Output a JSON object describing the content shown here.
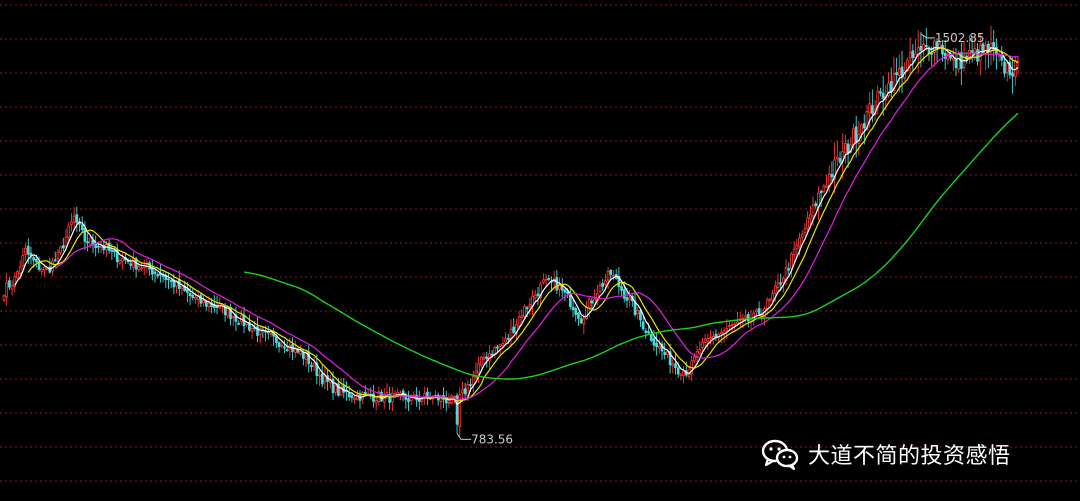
{
  "chart_data": {
    "type": "candlestick",
    "grid": true,
    "grid_style": "dotted-horizontal",
    "colors": {
      "background": "#000000",
      "grid": "#8a1a1a",
      "candle_up": "#ff3b3b",
      "candle_down": "#4fd8d8",
      "ma_short": "#ffffff",
      "ma_mid": "#e8e800",
      "ma_long": "#e020e0",
      "ma_longest": "#1bd01b",
      "annotation": "#c8c8c8"
    },
    "ylim": [
      700,
      1560
    ],
    "annotations": {
      "high_label": "1502.85",
      "low_label": "783.56"
    },
    "anchors": [
      [
        0,
        1040
      ],
      [
        4,
        1060
      ],
      [
        8,
        1110
      ],
      [
        12,
        1085
      ],
      [
        16,
        1075
      ],
      [
        20,
        1100
      ],
      [
        26,
        1170
      ],
      [
        30,
        1130
      ],
      [
        36,
        1120
      ],
      [
        42,
        1100
      ],
      [
        50,
        1085
      ],
      [
        58,
        1070
      ],
      [
        66,
        1040
      ],
      [
        72,
        1020
      ],
      [
        80,
        1010
      ],
      [
        88,
        985
      ],
      [
        96,
        960
      ],
      [
        104,
        945
      ],
      [
        112,
        920
      ],
      [
        118,
        882
      ],
      [
        124,
        858
      ],
      [
        130,
        852
      ],
      [
        138,
        850
      ],
      [
        146,
        847
      ],
      [
        152,
        845
      ],
      [
        158,
        848
      ],
      [
        163,
        846
      ],
      [
        168,
        838
      ],
      [
        172,
        868
      ],
      [
        178,
        920
      ],
      [
        186,
        948
      ],
      [
        192,
        1000
      ],
      [
        200,
        1052
      ],
      [
        205,
        1050
      ],
      [
        210,
        1020
      ],
      [
        214,
        990
      ],
      [
        220,
        1040
      ],
      [
        225,
        1070
      ],
      [
        232,
        1020
      ],
      [
        238,
        970
      ],
      [
        244,
        930
      ],
      [
        250,
        900
      ],
      [
        254,
        895
      ],
      [
        258,
        935
      ],
      [
        264,
        960
      ],
      [
        270,
        975
      ],
      [
        278,
        990
      ],
      [
        284,
        1020
      ],
      [
        290,
        1075
      ],
      [
        296,
        1140
      ],
      [
        304,
        1230
      ],
      [
        312,
        1290
      ],
      [
        318,
        1340
      ],
      [
        326,
        1395
      ],
      [
        334,
        1440
      ],
      [
        340,
        1470
      ],
      [
        346,
        1485
      ],
      [
        352,
        1445
      ],
      [
        358,
        1460
      ],
      [
        366,
        1470
      ],
      [
        370,
        1440
      ],
      [
        376,
        1435
      ]
    ],
    "high_index": 340,
    "low_index": 168,
    "n_candles": 377,
    "series": [
      {
        "period": 5,
        "color_key": "ma_short"
      },
      {
        "period": 10,
        "color_key": "ma_mid"
      },
      {
        "period": 20,
        "color_key": "ma_long"
      },
      {
        "period": 90,
        "color_key": "ma_longest"
      }
    ]
  },
  "watermark": {
    "text": "大道不简的投资感悟"
  }
}
